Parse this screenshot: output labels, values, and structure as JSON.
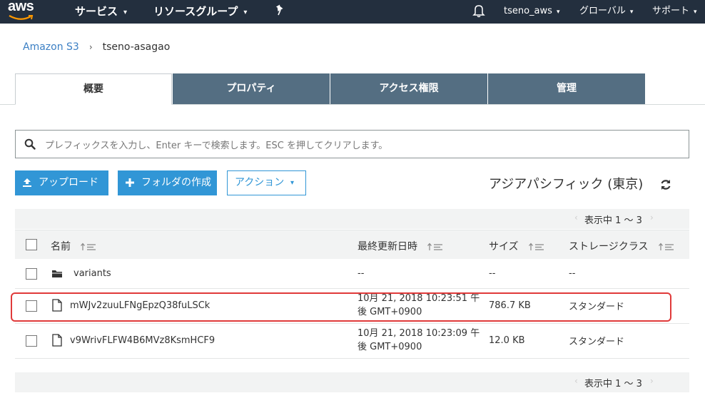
{
  "topbar": {
    "logo_text": "aws",
    "services": "サービス",
    "resource_groups": "リソースグループ",
    "user": "tseno_aws",
    "region": "グローバル",
    "support": "サポート",
    "caret": "▾"
  },
  "breadcrumb": {
    "root": "Amazon S3",
    "separator": "›",
    "current": "tseno-asagao"
  },
  "tabs": [
    {
      "label": "概要",
      "active": true
    },
    {
      "label": "プロパティ",
      "active": false
    },
    {
      "label": "アクセス権限",
      "active": false
    },
    {
      "label": "管理",
      "active": false
    }
  ],
  "search": {
    "placeholder": "プレフィックスを入力し、Enter キーで検索します。ESC を押してクリアします。"
  },
  "actions": {
    "upload": "アップロード",
    "create_folder": "フォルダの作成",
    "actions": "アクション",
    "region_label": "アジアパシフィック (東京)"
  },
  "pager": {
    "label": "表示中 1 ～ 3",
    "prev": "‹",
    "next": "›"
  },
  "table": {
    "headers": {
      "name": "名前",
      "modified": "最終更新日時",
      "size": "サイズ",
      "storage_class": "ストレージクラス"
    },
    "rows": [
      {
        "type": "folder",
        "name": "variants",
        "modified_1": "--",
        "modified_2": "",
        "size": "--",
        "storage_class": "--"
      },
      {
        "type": "file",
        "name": "mWJv2zuuLFNgEpzQ38fuLSCk",
        "modified_1": "10月 21, 2018 10:23:51 午",
        "modified_2": "後 GMT+0900",
        "size": "786.7 KB",
        "storage_class": "スタンダード"
      },
      {
        "type": "file",
        "name": "v9WrivFLFW4B6MVz8KsmHCF9",
        "modified_1": "10月 21, 2018 10:23:09 午",
        "modified_2": "後 GMT+0900",
        "size": "12.0 KB",
        "storage_class": "スタンダード"
      }
    ]
  },
  "colors": {
    "topbar": "#232f3e",
    "tab_inactive": "#546e82",
    "primary_button": "#3196d6",
    "link": "#3b7fc4",
    "highlight": "#e03a3a"
  },
  "icons": [
    "aws-logo",
    "pin-icon",
    "bell-icon",
    "search-icon",
    "upload-icon",
    "plus-icon",
    "refresh-icon",
    "sort-icon",
    "folder-icon",
    "file-icon"
  ]
}
